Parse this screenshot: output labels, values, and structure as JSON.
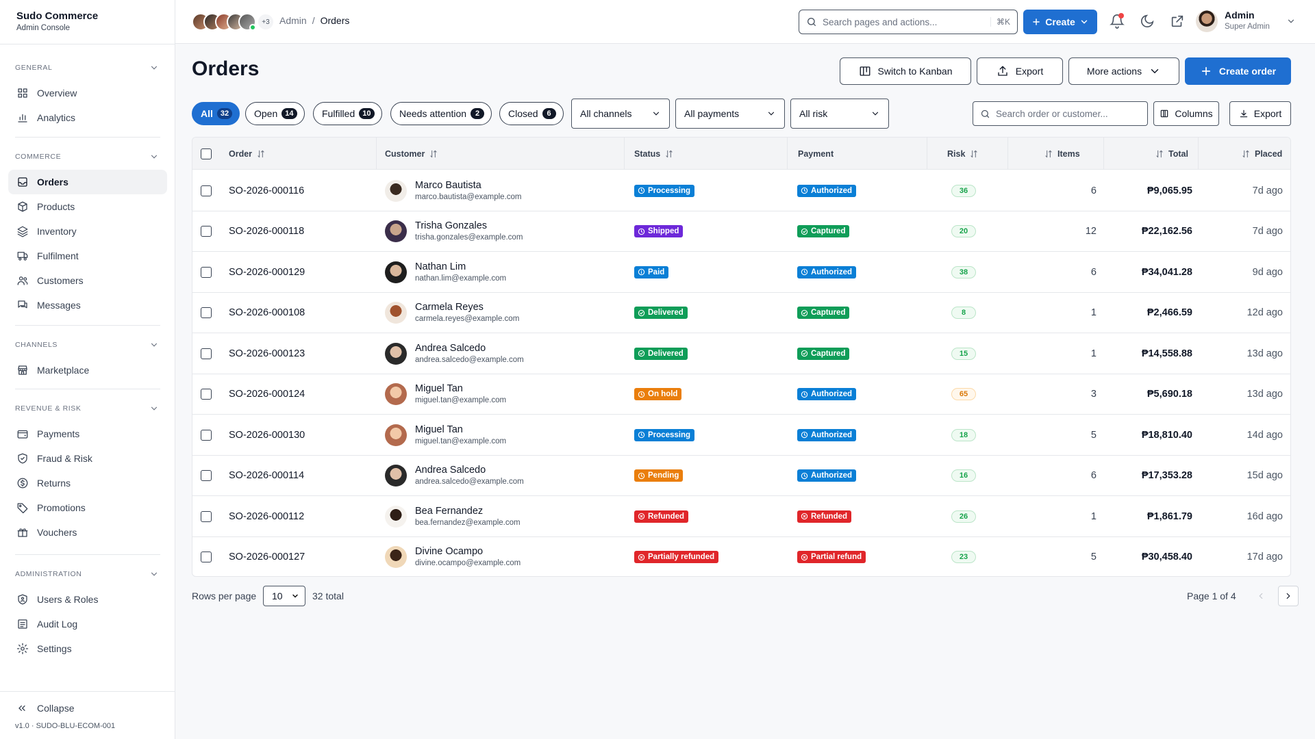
{
  "brand": {
    "name": "Sudo Commerce",
    "subtitle": "Admin Console"
  },
  "sidebar": {
    "sections": [
      {
        "title": "GENERAL",
        "items": [
          {
            "label": "Overview",
            "icon": "grid-icon"
          },
          {
            "label": "Analytics",
            "icon": "bar-chart-icon"
          }
        ]
      },
      {
        "title": "COMMERCE",
        "items": [
          {
            "label": "Orders",
            "icon": "inbox-icon",
            "active": true
          },
          {
            "label": "Products",
            "icon": "box-icon"
          },
          {
            "label": "Inventory",
            "icon": "layers-icon"
          },
          {
            "label": "Fulfilment",
            "icon": "truck-icon"
          },
          {
            "label": "Customers",
            "icon": "users-icon"
          },
          {
            "label": "Messages",
            "icon": "messages-icon"
          }
        ]
      },
      {
        "title": "CHANNELS",
        "items": [
          {
            "label": "Marketplace",
            "icon": "store-icon"
          }
        ]
      },
      {
        "title": "REVENUE & RISK",
        "items": [
          {
            "label": "Payments",
            "icon": "wallet-icon"
          },
          {
            "label": "Fraud & Risk",
            "icon": "shield-check-icon"
          },
          {
            "label": "Returns",
            "icon": "dollar-circle-icon"
          },
          {
            "label": "Promotions",
            "icon": "tag-icon"
          },
          {
            "label": "Vouchers",
            "icon": "gift-icon"
          }
        ]
      },
      {
        "title": "ADMINISTRATION",
        "items": [
          {
            "label": "Users & Roles",
            "icon": "shield-user-icon"
          },
          {
            "label": "Audit Log",
            "icon": "list-icon"
          },
          {
            "label": "Settings",
            "icon": "gear-icon"
          }
        ]
      }
    ],
    "collapse_label": "Collapse",
    "version": "v1.0 · SUDO-BLU-ECOM-001"
  },
  "header": {
    "presence_more": "+3",
    "breadcrumb": [
      "Admin",
      "Orders"
    ],
    "search_placeholder": "Search pages and actions...",
    "search_shortcut": "⌘K",
    "create_label": "Create",
    "user": {
      "name": "Admin",
      "role": "Super Admin"
    }
  },
  "page": {
    "title": "Orders",
    "actions": {
      "kanban": "Switch to Kanban",
      "export": "Export",
      "more": "More actions",
      "create": "Create order"
    }
  },
  "filters": {
    "tabs": [
      {
        "label": "All",
        "count": "32",
        "active": true
      },
      {
        "label": "Open",
        "count": "14"
      },
      {
        "label": "Fulfilled",
        "count": "10"
      },
      {
        "label": "Needs attention",
        "count": "2"
      },
      {
        "label": "Closed",
        "count": "6"
      }
    ],
    "channels": "All channels",
    "payments": "All payments",
    "risk": "All risk",
    "search_placeholder": "Search order or customer...",
    "columns_label": "Columns",
    "export_label": "Export"
  },
  "table": {
    "columns": {
      "order": "Order",
      "customer": "Customer",
      "status": "Status",
      "payment": "Payment",
      "risk": "Risk",
      "items": "Items",
      "total": "Total",
      "placed": "Placed"
    },
    "rows": [
      {
        "order": "SO-2026-000116",
        "name": "Marco Bautista",
        "email": "marco.bautista@example.com",
        "status": "Processing",
        "payment": "Authorized",
        "risk": "36",
        "items": "6",
        "total": "₱9,065.95",
        "placed": "7d ago"
      },
      {
        "order": "SO-2026-000118",
        "name": "Trisha Gonzales",
        "email": "trisha.gonzales@example.com",
        "status": "Shipped",
        "payment": "Captured",
        "risk": "20",
        "items": "12",
        "total": "₱22,162.56",
        "placed": "7d ago"
      },
      {
        "order": "SO-2026-000129",
        "name": "Nathan Lim",
        "email": "nathan.lim@example.com",
        "status": "Paid",
        "payment": "Authorized",
        "risk": "38",
        "items": "6",
        "total": "₱34,041.28",
        "placed": "9d ago"
      },
      {
        "order": "SO-2026-000108",
        "name": "Carmela Reyes",
        "email": "carmela.reyes@example.com",
        "status": "Delivered",
        "payment": "Captured",
        "risk": "8",
        "items": "1",
        "total": "₱2,466.59",
        "placed": "12d ago"
      },
      {
        "order": "SO-2026-000123",
        "name": "Andrea Salcedo",
        "email": "andrea.salcedo@example.com",
        "status": "Delivered",
        "payment": "Captured",
        "risk": "15",
        "items": "1",
        "total": "₱14,558.88",
        "placed": "13d ago"
      },
      {
        "order": "SO-2026-000124",
        "name": "Miguel Tan",
        "email": "miguel.tan@example.com",
        "status": "On hold",
        "payment": "Authorized",
        "risk": "65",
        "items": "3",
        "total": "₱5,690.18",
        "placed": "13d ago"
      },
      {
        "order": "SO-2026-000130",
        "name": "Miguel Tan",
        "email": "miguel.tan@example.com",
        "status": "Processing",
        "payment": "Authorized",
        "risk": "18",
        "items": "5",
        "total": "₱18,810.40",
        "placed": "14d ago"
      },
      {
        "order": "SO-2026-000114",
        "name": "Andrea Salcedo",
        "email": "andrea.salcedo@example.com",
        "status": "Pending",
        "payment": "Authorized",
        "risk": "16",
        "items": "6",
        "total": "₱17,353.28",
        "placed": "15d ago"
      },
      {
        "order": "SO-2026-000112",
        "name": "Bea Fernandez",
        "email": "bea.fernandez@example.com",
        "status": "Refunded",
        "payment": "Refunded",
        "risk": "26",
        "items": "1",
        "total": "₱1,861.79",
        "placed": "16d ago"
      },
      {
        "order": "SO-2026-000127",
        "name": "Divine Ocampo",
        "email": "divine.ocampo@example.com",
        "status": "Partially refunded",
        "payment": "Partial refund",
        "risk": "23",
        "items": "5",
        "total": "₱30,458.40",
        "placed": "17d ago"
      }
    ]
  },
  "pagination": {
    "rows_per_page_label": "Rows per page",
    "rows_per_page": "10",
    "total": "32 total",
    "page_info": "Page 1 of 4"
  },
  "colors": {
    "primary": "#1f6fd1",
    "processing": "#0a7fd6",
    "shipped": "#6d28d9",
    "paid": "#0a7fd6",
    "delivered": "#0f9d58",
    "on_hold": "#ea7e0c",
    "pending": "#ea7e0c",
    "refunded": "#e0262a",
    "risk_low": "#16a34a",
    "risk_medium": "#d97706"
  }
}
